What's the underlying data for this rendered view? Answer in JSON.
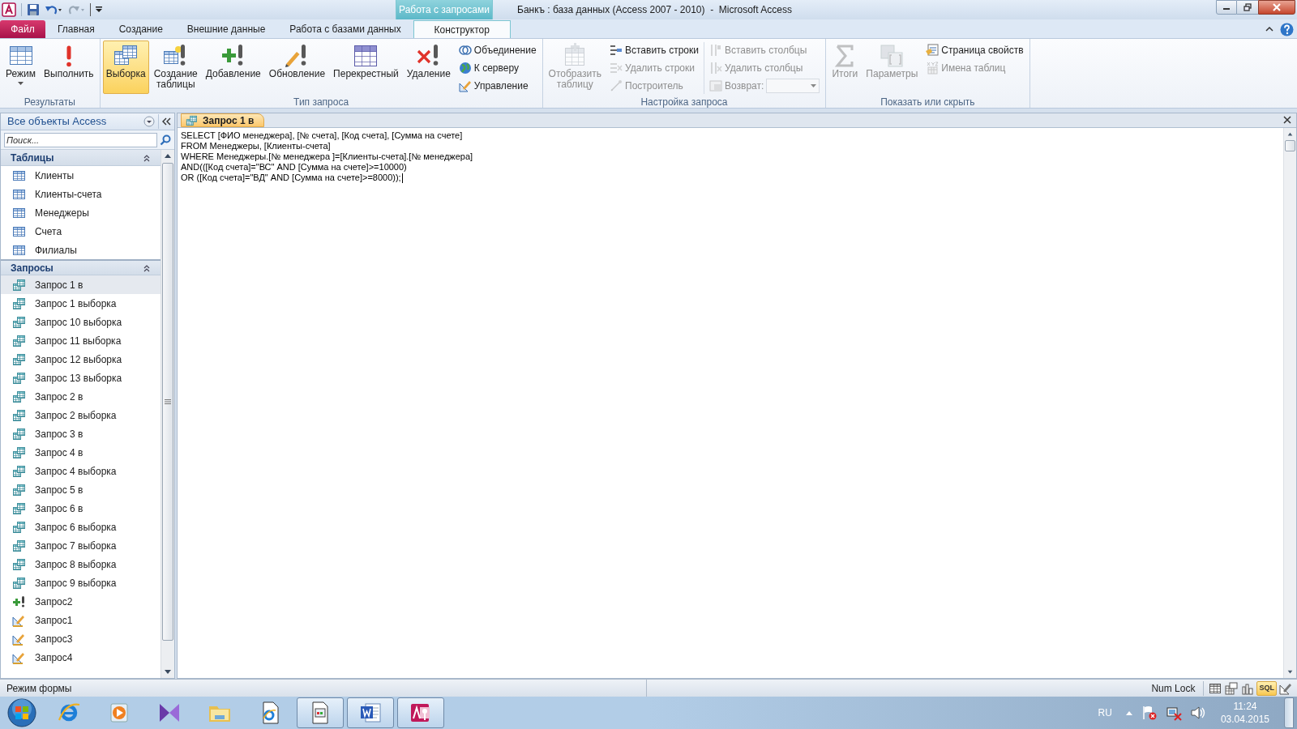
{
  "title_bar": {
    "title": "Банкъ : база данных (Access 2007 - 2010)  -  Microsoft Access",
    "context_tab": "Работа с запросами"
  },
  "ribbon_tabs": [
    {
      "label": "Файл",
      "kind": "file",
      "selected": false
    },
    {
      "label": "Главная",
      "kind": "tab",
      "selected": false
    },
    {
      "label": "Создание",
      "kind": "tab",
      "selected": false
    },
    {
      "label": "Внешние данные",
      "kind": "tab",
      "selected": false
    },
    {
      "label": "Работа с базами данных",
      "kind": "tab",
      "selected": false
    },
    {
      "label": "Конструктор",
      "kind": "tab",
      "selected": true
    }
  ],
  "ribbon_groups": [
    {
      "label": "Результаты",
      "items": [
        {
          "kind": "large",
          "label": "Режим",
          "dropdown": true,
          "selected": false,
          "disabled": false
        },
        {
          "kind": "large",
          "label": "Выполнить",
          "selected": false,
          "disabled": false
        }
      ]
    },
    {
      "label": "Тип запроса",
      "items": [
        {
          "kind": "large",
          "label": "Выборка",
          "selected": true,
          "disabled": false
        },
        {
          "kind": "large",
          "label": "Создание\nтаблицы",
          "selected": false,
          "disabled": false
        },
        {
          "kind": "large",
          "label": "Добавление",
          "selected": false,
          "disabled": false
        },
        {
          "kind": "large",
          "label": "Обновление",
          "selected": false,
          "disabled": false
        },
        {
          "kind": "large",
          "label": "Перекрестный",
          "selected": false,
          "disabled": false
        },
        {
          "kind": "large",
          "label": "Удаление",
          "selected": false,
          "disabled": false
        },
        {
          "kind": "stack",
          "buttons": [
            {
              "kind": "button",
              "label": "Объединение",
              "disabled": false
            },
            {
              "kind": "button",
              "label": "К серверу",
              "disabled": false
            },
            {
              "kind": "button",
              "label": "Управление",
              "disabled": false
            }
          ]
        }
      ]
    },
    {
      "label": "Настройка запроса",
      "items": [
        {
          "kind": "large",
          "label": "Отобразить\nтаблицу",
          "selected": false,
          "disabled": true
        },
        {
          "kind": "stack",
          "buttons": [
            {
              "kind": "button",
              "label": "Вставить строки",
              "disabled": false
            },
            {
              "kind": "button",
              "label": "Удалить строки",
              "disabled": true
            },
            {
              "kind": "button",
              "label": "Построитель",
              "disabled": true
            }
          ]
        },
        {
          "kind": "stack",
          "buttons": [
            {
              "kind": "button",
              "label": "Вставить столбцы",
              "disabled": true
            },
            {
              "kind": "button",
              "label": "Удалить столбцы",
              "disabled": true
            },
            {
              "kind": "combo",
              "label": "Возврат:",
              "disabled": true
            }
          ]
        }
      ]
    },
    {
      "label": "Показать или скрыть",
      "items": [
        {
          "kind": "large",
          "label": "Итоги",
          "selected": false,
          "disabled": true
        },
        {
          "kind": "large",
          "label": "Параметры",
          "selected": false,
          "disabled": true
        },
        {
          "kind": "stack",
          "buttons": [
            {
              "kind": "button",
              "label": "Страница свойств",
              "disabled": false
            },
            {
              "kind": "button",
              "label": "Имена таблиц",
              "disabled": true
            }
          ]
        }
      ]
    }
  ],
  "navigation_pane": {
    "title": "Все объекты Access",
    "search": {
      "placeholder": "Поиск..."
    },
    "groups": [
      {
        "label": "Таблицы",
        "expanded": true,
        "items": [
          {
            "label": "Клиенты",
            "kind": "table",
            "selected": false
          },
          {
            "label": "Клиенты-счета",
            "kind": "table",
            "selected": false
          },
          {
            "label": "Менеджеры",
            "kind": "table",
            "selected": false
          },
          {
            "label": "Счета",
            "kind": "table",
            "selected": false
          },
          {
            "label": "Филиалы",
            "kind": "table",
            "selected": false
          }
        ]
      },
      {
        "label": "Запросы",
        "expanded": true,
        "items": [
          {
            "label": "Запрос 1 в",
            "kind": "select",
            "selected": true
          },
          {
            "label": "Запрос 1 выборка",
            "kind": "select",
            "selected": false
          },
          {
            "label": "Запрос 10 выборка",
            "kind": "select",
            "selected": false
          },
          {
            "label": "Запрос 11 выборка",
            "kind": "select",
            "selected": false
          },
          {
            "label": "Запрос 12 выборка",
            "kind": "select",
            "selected": false
          },
          {
            "label": "Запрос 13 выборка",
            "kind": "select",
            "selected": false
          },
          {
            "label": "Запрос 2 в",
            "kind": "select",
            "selected": false
          },
          {
            "label": "Запрос 2 выборка",
            "kind": "select",
            "selected": false
          },
          {
            "label": "Запрос 3 в",
            "kind": "select",
            "selected": false
          },
          {
            "label": "Запрос 4 в",
            "kind": "select",
            "selected": false
          },
          {
            "label": "Запрос 4 выборка",
            "kind": "select",
            "selected": false
          },
          {
            "label": "Запрос 5 в",
            "kind": "select",
            "selected": false
          },
          {
            "label": "Запрос 6 в",
            "kind": "select",
            "selected": false
          },
          {
            "label": "Запрос 6 выборка",
            "kind": "select",
            "selected": false
          },
          {
            "label": "Запрос 7 выборка",
            "kind": "select",
            "selected": false
          },
          {
            "label": "Запрос 8 выборка",
            "kind": "select",
            "selected": false
          },
          {
            "label": "Запрос 9 выборка",
            "kind": "select",
            "selected": false
          },
          {
            "label": "Запрос2",
            "kind": "append",
            "selected": false
          },
          {
            "label": "Запрос1",
            "kind": "definition",
            "selected": false
          },
          {
            "label": "Запрос3",
            "kind": "definition",
            "selected": false
          },
          {
            "label": "Запрос4",
            "kind": "definition",
            "selected": false
          }
        ]
      }
    ]
  },
  "document_tabs": [
    {
      "label": "Запрос 1 в",
      "selected": true
    }
  ],
  "sql_editor": {
    "lines": [
      "SELECT [ФИО менеджера], [№ счета], [Код счета], [Сумма на счете]",
      "FROM Менеджеры, [Клиенты-счета]",
      "WHERE Менеджеры.[№ менеджера ]=[Клиенты-счета].[№ менеджера]",
      "AND(([Код счета]=\"ВС\" AND [Сумма на счете]>=10000)",
      "OR ([Код счета]=\"ВД\" AND [Сумма на счете]>=8000));"
    ]
  },
  "status_bar": {
    "text": "Режим формы",
    "num_lock": "Num Lock",
    "views": [
      {
        "kind": "datasheet",
        "selected": false
      },
      {
        "kind": "pivot-table",
        "selected": false
      },
      {
        "kind": "pivot-chart",
        "selected": false
      },
      {
        "kind": "sql",
        "label": "SQL",
        "selected": true
      },
      {
        "kind": "design",
        "selected": false
      }
    ]
  },
  "taskbar": {
    "items": [
      {
        "kind": "browser",
        "running": false
      },
      {
        "kind": "media",
        "running": false
      },
      {
        "kind": "video",
        "running": false
      },
      {
        "kind": "folder",
        "running": false
      },
      {
        "kind": "web-document",
        "running": false
      },
      {
        "kind": "window-app",
        "running": true
      },
      {
        "kind": "word",
        "running": true
      },
      {
        "kind": "access",
        "running": true
      }
    ],
    "tray": {
      "language": "RU",
      "time": "11:24",
      "date": "03.04.2015"
    }
  }
}
